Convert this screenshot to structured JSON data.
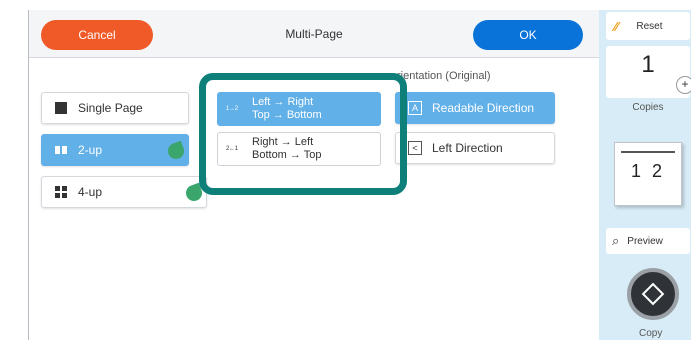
{
  "header": {
    "cancel_label": "Cancel",
    "title": "Multi-Page",
    "ok_label": "OK"
  },
  "layout_options": [
    {
      "label": "Single Page",
      "icon": "single-page-icon",
      "selected": false
    },
    {
      "label": "2-up",
      "icon": "two-up-icon",
      "selected": true,
      "eco": true
    },
    {
      "label": "4-up",
      "icon": "four-up-icon",
      "selected": false,
      "eco": true
    }
  ],
  "order_options": [
    {
      "line1": "Left → Right",
      "line2": "Top → Bottom",
      "icon_text": "1→2",
      "selected": true
    },
    {
      "line1": "Right → Left",
      "line2": "Bottom → Top",
      "icon_text": "2←1",
      "selected": false
    }
  ],
  "orientation": {
    "label": "rientation (Original)",
    "options": [
      {
        "label": "Readable Direction",
        "icon_text": "A",
        "selected": true
      },
      {
        "label": "Left Direction",
        "icon_text": "<",
        "selected": false
      }
    ]
  },
  "sidebar": {
    "reset_label": "Reset",
    "copies_value": "1",
    "copies_label": "Copies",
    "thumb_text": "1 2",
    "preview_label": "Preview",
    "copy_label": "Copy"
  },
  "colors": {
    "cancel": "#f05a28",
    "ok": "#0a73d9",
    "selected": "#62b0e8",
    "highlight": "#0e7f79",
    "eco_leaf": "#3aa66b"
  }
}
